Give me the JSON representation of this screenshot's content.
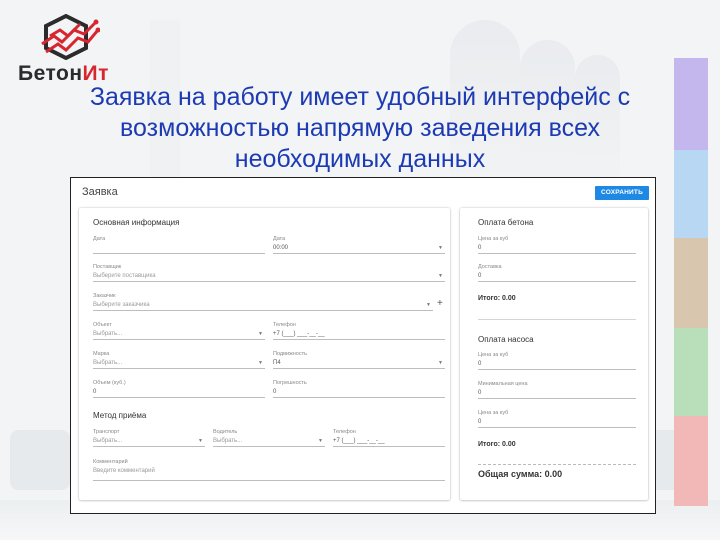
{
  "brand": {
    "name_part1": "Бетон",
    "name_part2": "Ит",
    "accent": "#d8262f"
  },
  "headline": "Заявка на работу имеет удобный интерфейс с возможностью напрямую заведения всех необходимых данных",
  "form": {
    "title": "Заявка",
    "save_label": "СОХРАНИТЬ",
    "main": {
      "section_title": "Основная информация",
      "date1": {
        "label": "Дата",
        "value": ""
      },
      "date2": {
        "label": "Дата",
        "value": "00:00"
      },
      "supplier": {
        "label": "Поставщик",
        "placeholder": "Выберите поставщика"
      },
      "customer": {
        "label": "Заказчик",
        "placeholder": "Выберите заказчика"
      },
      "object": {
        "label": "Объект",
        "placeholder": "Выбрать..."
      },
      "phone": {
        "label": "Телефон",
        "value": "+7 (___) ___-__-__"
      },
      "grade": {
        "label": "Марка",
        "placeholder": "Выбрать..."
      },
      "mobility": {
        "label": "Подвижность",
        "value": "П4"
      },
      "volume": {
        "label": "Объем (куб.)",
        "value": "0"
      },
      "error": {
        "label": "Погрешность",
        "value": "0"
      }
    },
    "receive": {
      "section_title": "Метод приёма",
      "transport": {
        "label": "Транспорт",
        "placeholder": "Выбрать..."
      },
      "driver": {
        "label": "Водитель",
        "placeholder": "Выбрать..."
      },
      "phone": {
        "label": "Телефон",
        "value": "+7 (___) ___-__-__"
      },
      "comment": {
        "label": "Комментарий",
        "placeholder": "Введите комментарий"
      }
    },
    "concrete_payment": {
      "section_title": "Оплата бетона",
      "price": {
        "label": "Цена за куб",
        "value": "0"
      },
      "delivery": {
        "label": "Доставка",
        "value": "0"
      },
      "total": "Итого: 0.00"
    },
    "pump_payment": {
      "section_title": "Оплата насоса",
      "price": {
        "label": "Цена за куб",
        "value": "0"
      },
      "min_price": {
        "label": "Минимальная цена",
        "value": "0"
      },
      "price2": {
        "label": "Цена за куб",
        "value": "0"
      },
      "total": "Итого: 0.00"
    },
    "grand_total": "Общая сумма: 0.00"
  },
  "colors": {
    "headline": "#1c3bb3",
    "button": "#1e88e5",
    "stripes": [
      "#c3b7ee",
      "#b8d7f2",
      "#d8c7ae",
      "#b9dfba",
      "#f2b7b7"
    ]
  }
}
